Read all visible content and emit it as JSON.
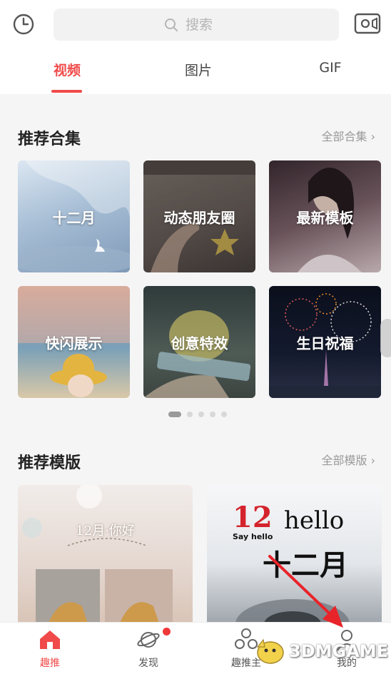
{
  "search": {
    "placeholder": "搜索"
  },
  "tabs": [
    {
      "label": "视频",
      "active": true
    },
    {
      "label": "图片",
      "active": false
    },
    {
      "label": "GIF",
      "active": false
    }
  ],
  "collections": {
    "title": "推荐合集",
    "more_label": "全部合集",
    "items": [
      {
        "label": "十二月"
      },
      {
        "label": "动态朋友圈"
      },
      {
        "label": "最新模板"
      },
      {
        "label": "快闪展示"
      },
      {
        "label": "创意特效"
      },
      {
        "label": "生日祝福"
      }
    ],
    "carousel": {
      "pages": 5,
      "current": 1
    }
  },
  "templates": {
    "title": "推荐模版",
    "more_label": "全部模版",
    "items": [
      {
        "overlay_text": "12月·你好"
      },
      {
        "overlay_lines": [
          "12",
          "hello",
          "Say hello",
          "十二月"
        ]
      }
    ]
  },
  "bottom_nav": [
    {
      "label": "趣推",
      "icon": "home-icon",
      "active": true
    },
    {
      "label": "发现",
      "icon": "planet-icon",
      "active": false,
      "badge": true
    },
    {
      "label": "趣推主",
      "icon": "circles-icon",
      "active": false
    },
    {
      "label": "我的",
      "icon": "user-icon",
      "active": false
    }
  ],
  "colors": {
    "accent": "#f04a4a",
    "muted": "#9a9a9a",
    "arrow": "#e8242b"
  },
  "watermark": "3DMGAME"
}
